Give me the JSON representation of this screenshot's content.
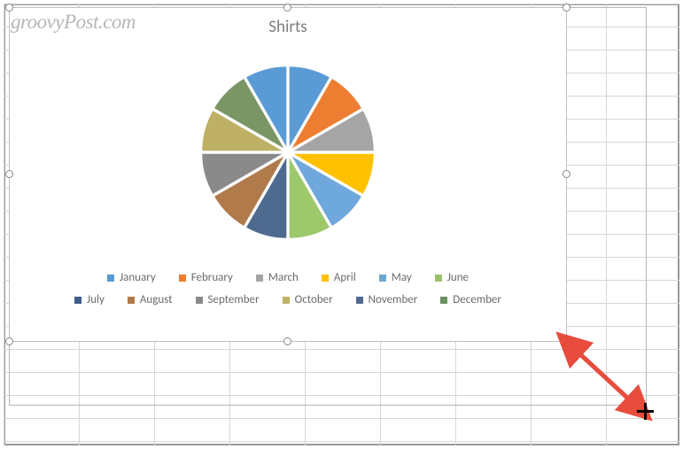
{
  "watermark": "groovyPost.com",
  "chart_data": {
    "type": "pie",
    "title": "Shirts",
    "categories": [
      "January",
      "February",
      "March",
      "April",
      "May",
      "June",
      "July",
      "August",
      "September",
      "October",
      "November",
      "December"
    ],
    "values": [
      1,
      1,
      1,
      1,
      1,
      1,
      1,
      1,
      1,
      1,
      1,
      1
    ],
    "colors": [
      "#5b9bd5",
      "#ed7d31",
      "#a5a5a5",
      "#ffc000",
      "#70ad47",
      "#8faadc",
      "#9dc3e6",
      "#b4c7e7",
      "#c55a11",
      "#7f7f7f",
      "#bf9000",
      "#548235"
    ],
    "slice_colors": [
      "#5b9bd5",
      "#ed7d31",
      "#a5a5a5",
      "#ffc000",
      "#6fa8dc",
      "#9dc96b",
      "#4f6a8f",
      "#b07a4a",
      "#8a8a8a",
      "#beb165",
      "#7b9665",
      "#5b9bd5"
    ],
    "legend_position": "bottom",
    "exploded": true
  },
  "legend": {
    "rows": [
      [
        {
          "label": "January",
          "color": "#5b9bd5"
        },
        {
          "label": "February",
          "color": "#ed7d31"
        },
        {
          "label": "March",
          "color": "#a5a5a5"
        },
        {
          "label": "April",
          "color": "#ffc000"
        },
        {
          "label": "May",
          "color": "#70a7d1"
        },
        {
          "label": "June",
          "color": "#9bc06b"
        }
      ],
      [
        {
          "label": "July",
          "color": "#3f5e85"
        },
        {
          "label": "August",
          "color": "#b07a4a"
        },
        {
          "label": "September",
          "color": "#8a8a8a"
        },
        {
          "label": "October",
          "color": "#beb165"
        },
        {
          "label": "November",
          "color": "#516a8c"
        },
        {
          "label": "December",
          "color": "#6b9060"
        }
      ]
    ]
  },
  "annotation": {
    "arrow_color": "#e74c3c"
  }
}
